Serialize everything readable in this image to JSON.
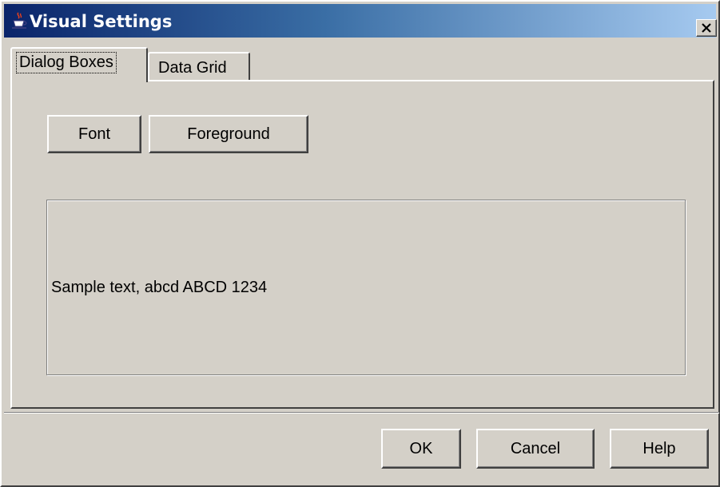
{
  "window": {
    "title": "Visual Settings",
    "icon": "java-cup-icon",
    "close_icon": "close-icon"
  },
  "tabs": [
    {
      "label": "Dialog Boxes",
      "selected": true
    },
    {
      "label": "Data Grid",
      "selected": false
    }
  ],
  "panel": {
    "font_button": "Font",
    "foreground_button": "Foreground",
    "sample_text": "Sample text, abcd ABCD 1234"
  },
  "footer": {
    "ok_button": "OK",
    "cancel_button": "Cancel",
    "help_button": "Help"
  },
  "colors": {
    "background": "#d4d0c8",
    "titlebar_start": "#0a246a",
    "titlebar_end": "#a6caf0",
    "title_text": "#ffffff"
  }
}
